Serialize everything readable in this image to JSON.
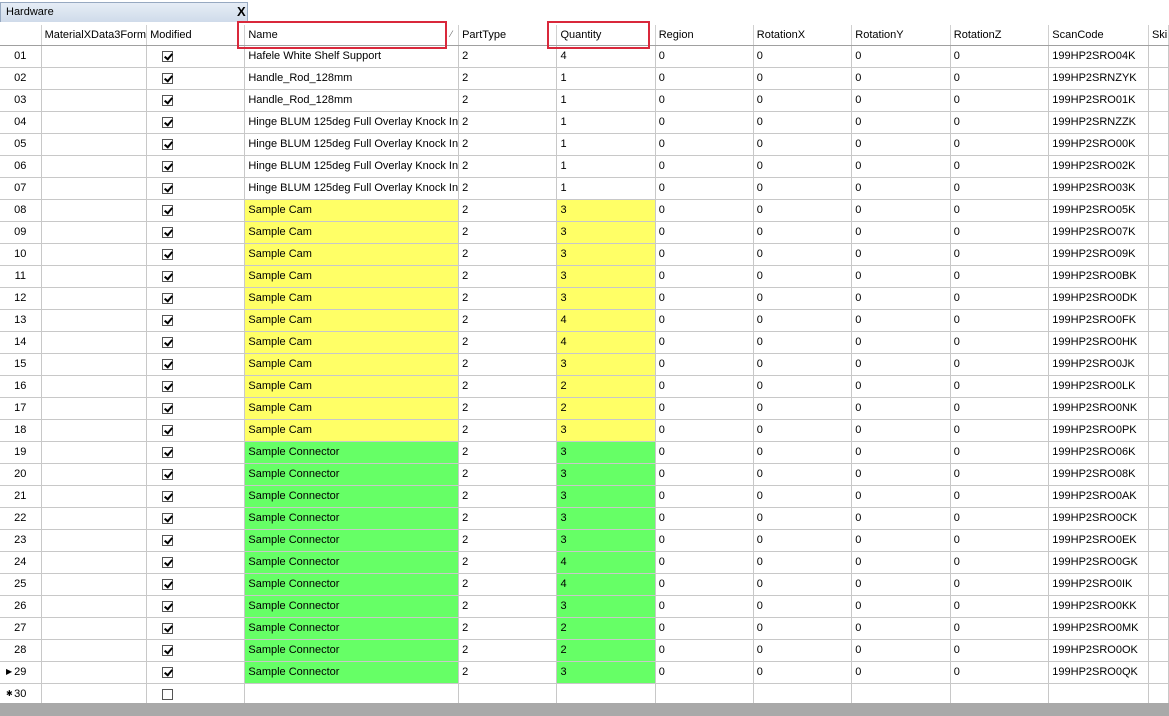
{
  "window": {
    "tab_title": "Hardware",
    "close_label": "X"
  },
  "columns": [
    "",
    "MaterialXData3Form",
    "Modified",
    "Name",
    "PartType",
    "Quantity",
    "Region",
    "RotationX",
    "RotationY",
    "RotationZ",
    "ScanCode",
    "Ski"
  ],
  "sorted_column": "Name",
  "highlighted_columns": [
    "Name",
    "Quantity"
  ],
  "colors": {
    "cam": "#ffff66",
    "connector": "#66ff66",
    "highlight_box": "#d9283b"
  },
  "rows": [
    {
      "num": "01",
      "modified": true,
      "name": "Hafele White Shelf Support",
      "parttype": "2",
      "quantity": "4",
      "region": "0",
      "rx": "0",
      "ry": "0",
      "rz": "0",
      "scancode": "199HP2SRO04K",
      "color": ""
    },
    {
      "num": "02",
      "modified": true,
      "name": "Handle_Rod_128mm",
      "parttype": "2",
      "quantity": "1",
      "region": "0",
      "rx": "0",
      "ry": "0",
      "rz": "0",
      "scancode": "199HP2SRNZYK",
      "color": ""
    },
    {
      "num": "03",
      "modified": true,
      "name": "Handle_Rod_128mm",
      "parttype": "2",
      "quantity": "1",
      "region": "0",
      "rx": "0",
      "ry": "0",
      "rz": "0",
      "scancode": "199HP2SRO01K",
      "color": ""
    },
    {
      "num": "04",
      "modified": true,
      "name": "Hinge BLUM 125deg Full Overlay Knock In",
      "parttype": "2",
      "quantity": "1",
      "region": "0",
      "rx": "0",
      "ry": "0",
      "rz": "0",
      "scancode": "199HP2SRNZZK",
      "color": ""
    },
    {
      "num": "05",
      "modified": true,
      "name": "Hinge BLUM 125deg Full Overlay Knock In",
      "parttype": "2",
      "quantity": "1",
      "region": "0",
      "rx": "0",
      "ry": "0",
      "rz": "0",
      "scancode": "199HP2SRO00K",
      "color": ""
    },
    {
      "num": "06",
      "modified": true,
      "name": "Hinge BLUM 125deg Full Overlay Knock In",
      "parttype": "2",
      "quantity": "1",
      "region": "0",
      "rx": "0",
      "ry": "0",
      "rz": "0",
      "scancode": "199HP2SRO02K",
      "color": ""
    },
    {
      "num": "07",
      "modified": true,
      "name": "Hinge BLUM 125deg Full Overlay Knock In",
      "parttype": "2",
      "quantity": "1",
      "region": "0",
      "rx": "0",
      "ry": "0",
      "rz": "0",
      "scancode": "199HP2SRO03K",
      "color": ""
    },
    {
      "num": "08",
      "modified": true,
      "name": "Sample Cam",
      "parttype": "2",
      "quantity": "3",
      "region": "0",
      "rx": "0",
      "ry": "0",
      "rz": "0",
      "scancode": "199HP2SRO05K",
      "color": "cam"
    },
    {
      "num": "09",
      "modified": true,
      "name": "Sample Cam",
      "parttype": "2",
      "quantity": "3",
      "region": "0",
      "rx": "0",
      "ry": "0",
      "rz": "0",
      "scancode": "199HP2SRO07K",
      "color": "cam"
    },
    {
      "num": "10",
      "modified": true,
      "name": "Sample Cam",
      "parttype": "2",
      "quantity": "3",
      "region": "0",
      "rx": "0",
      "ry": "0",
      "rz": "0",
      "scancode": "199HP2SRO09K",
      "color": "cam"
    },
    {
      "num": "11",
      "modified": true,
      "name": "Sample Cam",
      "parttype": "2",
      "quantity": "3",
      "region": "0",
      "rx": "0",
      "ry": "0",
      "rz": "0",
      "scancode": "199HP2SRO0BK",
      "color": "cam"
    },
    {
      "num": "12",
      "modified": true,
      "name": "Sample Cam",
      "parttype": "2",
      "quantity": "3",
      "region": "0",
      "rx": "0",
      "ry": "0",
      "rz": "0",
      "scancode": "199HP2SRO0DK",
      "color": "cam"
    },
    {
      "num": "13",
      "modified": true,
      "name": "Sample Cam",
      "parttype": "2",
      "quantity": "4",
      "region": "0",
      "rx": "0",
      "ry": "0",
      "rz": "0",
      "scancode": "199HP2SRO0FK",
      "color": "cam"
    },
    {
      "num": "14",
      "modified": true,
      "name": "Sample Cam",
      "parttype": "2",
      "quantity": "4",
      "region": "0",
      "rx": "0",
      "ry": "0",
      "rz": "0",
      "scancode": "199HP2SRO0HK",
      "color": "cam"
    },
    {
      "num": "15",
      "modified": true,
      "name": "Sample Cam",
      "parttype": "2",
      "quantity": "3",
      "region": "0",
      "rx": "0",
      "ry": "0",
      "rz": "0",
      "scancode": "199HP2SRO0JK",
      "color": "cam"
    },
    {
      "num": "16",
      "modified": true,
      "name": "Sample Cam",
      "parttype": "2",
      "quantity": "2",
      "region": "0",
      "rx": "0",
      "ry": "0",
      "rz": "0",
      "scancode": "199HP2SRO0LK",
      "color": "cam"
    },
    {
      "num": "17",
      "modified": true,
      "name": "Sample Cam",
      "parttype": "2",
      "quantity": "2",
      "region": "0",
      "rx": "0",
      "ry": "0",
      "rz": "0",
      "scancode": "199HP2SRO0NK",
      "color": "cam"
    },
    {
      "num": "18",
      "modified": true,
      "name": "Sample Cam",
      "parttype": "2",
      "quantity": "3",
      "region": "0",
      "rx": "0",
      "ry": "0",
      "rz": "0",
      "scancode": "199HP2SRO0PK",
      "color": "cam"
    },
    {
      "num": "19",
      "modified": true,
      "name": "Sample Connector",
      "parttype": "2",
      "quantity": "3",
      "region": "0",
      "rx": "0",
      "ry": "0",
      "rz": "0",
      "scancode": "199HP2SRO06K",
      "color": "connector"
    },
    {
      "num": "20",
      "modified": true,
      "name": "Sample Connector",
      "parttype": "2",
      "quantity": "3",
      "region": "0",
      "rx": "0",
      "ry": "0",
      "rz": "0",
      "scancode": "199HP2SRO08K",
      "color": "connector"
    },
    {
      "num": "21",
      "modified": true,
      "name": "Sample Connector",
      "parttype": "2",
      "quantity": "3",
      "region": "0",
      "rx": "0",
      "ry": "0",
      "rz": "0",
      "scancode": "199HP2SRO0AK",
      "color": "connector"
    },
    {
      "num": "22",
      "modified": true,
      "name": "Sample Connector",
      "parttype": "2",
      "quantity": "3",
      "region": "0",
      "rx": "0",
      "ry": "0",
      "rz": "0",
      "scancode": "199HP2SRO0CK",
      "color": "connector"
    },
    {
      "num": "23",
      "modified": true,
      "name": "Sample Connector",
      "parttype": "2",
      "quantity": "3",
      "region": "0",
      "rx": "0",
      "ry": "0",
      "rz": "0",
      "scancode": "199HP2SRO0EK",
      "color": "connector"
    },
    {
      "num": "24",
      "modified": true,
      "name": "Sample Connector",
      "parttype": "2",
      "quantity": "4",
      "region": "0",
      "rx": "0",
      "ry": "0",
      "rz": "0",
      "scancode": "199HP2SRO0GK",
      "color": "connector"
    },
    {
      "num": "25",
      "modified": true,
      "name": "Sample Connector",
      "parttype": "2",
      "quantity": "4",
      "region": "0",
      "rx": "0",
      "ry": "0",
      "rz": "0",
      "scancode": "199HP2SRO0IK",
      "color": "connector"
    },
    {
      "num": "26",
      "modified": true,
      "name": "Sample Connector",
      "parttype": "2",
      "quantity": "3",
      "region": "0",
      "rx": "0",
      "ry": "0",
      "rz": "0",
      "scancode": "199HP2SRO0KK",
      "color": "connector"
    },
    {
      "num": "27",
      "modified": true,
      "name": "Sample Connector",
      "parttype": "2",
      "quantity": "2",
      "region": "0",
      "rx": "0",
      "ry": "0",
      "rz": "0",
      "scancode": "199HP2SRO0MK",
      "color": "connector"
    },
    {
      "num": "28",
      "modified": true,
      "name": "Sample Connector",
      "parttype": "2",
      "quantity": "2",
      "region": "0",
      "rx": "0",
      "ry": "0",
      "rz": "0",
      "scancode": "199HP2SRO0OK",
      "color": "connector"
    },
    {
      "num": "29",
      "modified": true,
      "name": "Sample Connector",
      "parttype": "2",
      "quantity": "3",
      "region": "0",
      "rx": "0",
      "ry": "0",
      "rz": "0",
      "scancode": "199HP2SRO0QK",
      "color": "connector",
      "current": true
    }
  ],
  "new_row": {
    "num": "30",
    "modified": false
  },
  "row_markers": {
    "current": "▶",
    "new": "✱"
  }
}
